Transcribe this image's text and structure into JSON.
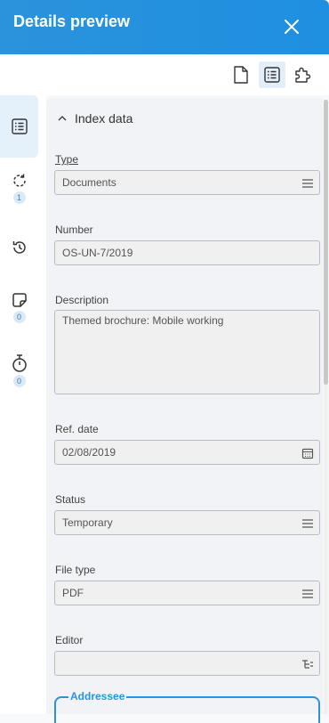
{
  "header": {
    "title": "Details preview"
  },
  "sidebar": {
    "badges": {
      "activity": "1",
      "notes": "0",
      "timers": "0"
    }
  },
  "section": {
    "title": "Index data"
  },
  "fields": {
    "type": {
      "label": "Type",
      "value": "Documents"
    },
    "number": {
      "label": "Number",
      "value": "OS-UN-7/2019"
    },
    "description": {
      "label": "Description",
      "value": "Themed brochure: Mobile working"
    },
    "ref_date": {
      "label": "Ref. date",
      "value": "02/08/2019"
    },
    "status": {
      "label": "Status",
      "value": "Temporary"
    },
    "file_type": {
      "label": "File type",
      "value": "PDF"
    },
    "editor": {
      "label": "Editor",
      "value": ""
    },
    "addressee": {
      "label": "Addressee"
    }
  },
  "colors": {
    "header": "#2a93dc",
    "accent": "#2a93dc",
    "active_bg": "#e3eef8"
  },
  "icons": {
    "toolbar": [
      "document-icon",
      "list-icon",
      "puzzle-icon"
    ],
    "sidebar": [
      "list-icon",
      "refresh-icon",
      "history-icon",
      "note-icon",
      "stopwatch-icon"
    ]
  }
}
